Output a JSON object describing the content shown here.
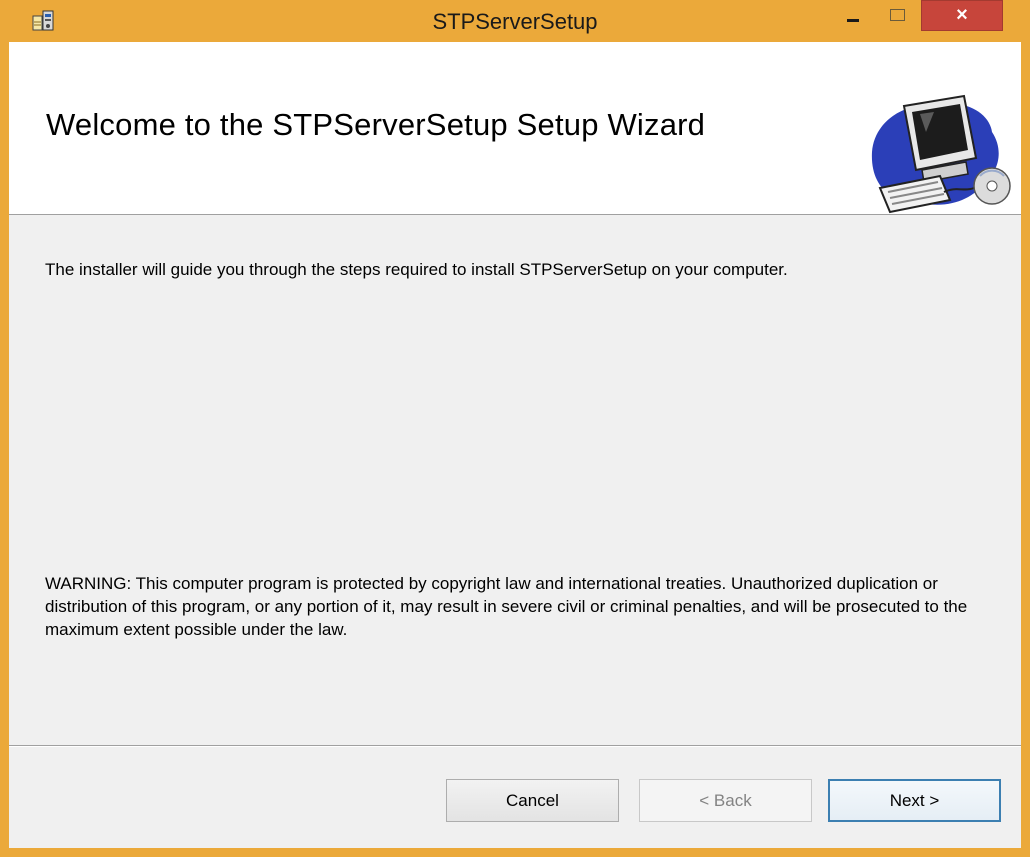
{
  "window": {
    "title": "STPServerSetup",
    "close_glyph": "×",
    "icons": {
      "app": "installer-icon",
      "min": "minimize-icon",
      "max": "maximize-icon"
    }
  },
  "banner": {
    "title": "Welcome to the STPServerSetup Setup Wizard",
    "art_icon": "computer-with-cd-icon"
  },
  "body": {
    "intro": "The installer will guide you through the steps required to install STPServerSetup on your computer.",
    "warning": "WARNING: This computer program is protected by copyright law and international treaties. Unauthorized duplication or distribution of this program, or any portion of it, may result in severe civil or criminal penalties, and will be prosecuted to the maximum extent possible under the law."
  },
  "buttons": {
    "cancel": "Cancel",
    "back": "< Back",
    "next": "Next >"
  },
  "colors": {
    "frame": "#eba93a",
    "close": "#c7453b",
    "default_button_border": "#3c7fb1"
  }
}
